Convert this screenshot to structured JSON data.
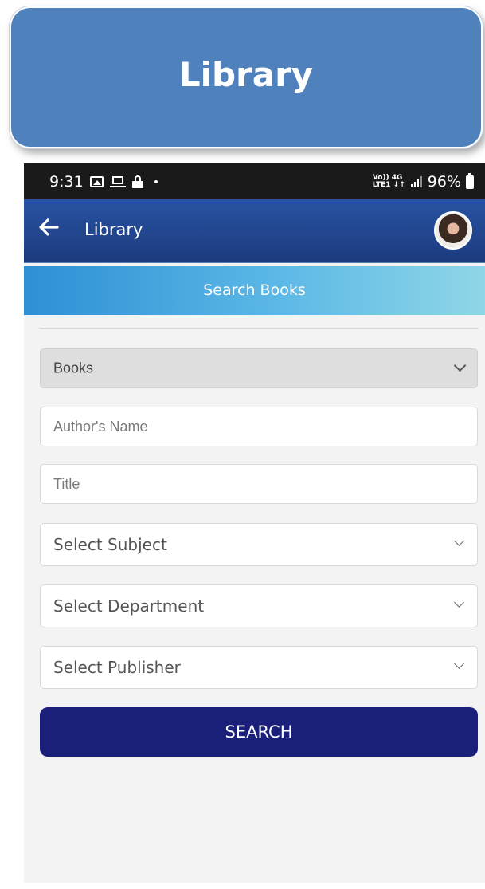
{
  "banner": {
    "title": "Library"
  },
  "status_bar": {
    "time": "9:31",
    "network_top": "Vo)) 4G",
    "network_bottom": "LTE1 ↓↑",
    "battery": "96%"
  },
  "app_bar": {
    "title": "Library"
  },
  "section": {
    "title": "Search Books"
  },
  "form": {
    "type_select": {
      "value": "Books"
    },
    "author_input": {
      "placeholder": "Author's Name",
      "value": ""
    },
    "title_input": {
      "placeholder": "Title",
      "value": ""
    },
    "subject_select": {
      "value": "Select Subject"
    },
    "department_select": {
      "value": "Select Department"
    },
    "publisher_select": {
      "value": "Select Publisher"
    },
    "search_label": "SEARCH"
  },
  "colors": {
    "banner": "#4f81bd",
    "app_bar": "#1d3b7e",
    "section_header": "#5bb8e6",
    "search_button": "#1a1f7a",
    "background": "#f3f3f3"
  },
  "icons": [
    "back-arrow-icon",
    "gallery-icon",
    "laptop-icon",
    "lock-icon",
    "signal-icon",
    "battery-icon",
    "chevron-down-icon",
    "avatar"
  ]
}
